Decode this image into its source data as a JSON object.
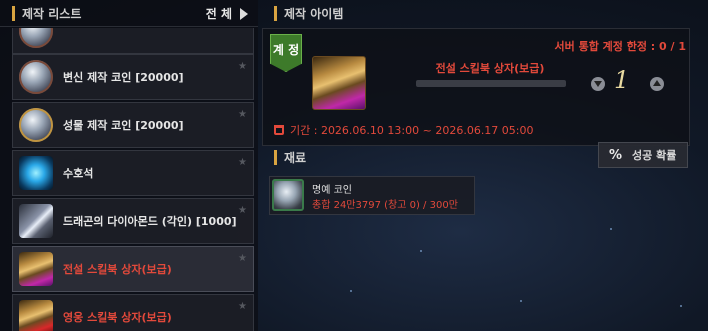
{
  "list_panel": {
    "title": "제작 리스트",
    "filter_label": "전 체",
    "items": [
      {
        "label": "",
        "icon": "coin-icon"
      },
      {
        "label": "변신 제작 코인 [20000]",
        "icon": "transform-coin-icon"
      },
      {
        "label": "성물 제작 코인 [20000]",
        "icon": "relic-coin-icon"
      },
      {
        "label": "수호석",
        "icon": "guardian-stone-icon"
      },
      {
        "label": "드래곤의 다이아몬드 (각인) [1000]",
        "icon": "dragon-diamond-icon"
      },
      {
        "label": "전설 스킬북 상자(보급)",
        "icon": "legend-skillbook-chest-icon",
        "selected": true
      },
      {
        "label": "영웅 스킬북 상자(보급)",
        "icon": "hero-skillbook-chest-icon"
      }
    ]
  },
  "craft_panel": {
    "title": "제작 아이템",
    "account_tag": "계 정",
    "server_limit": "서버 통합 계정 한정 : 0 / 1",
    "item_name": "전설 스킬북 상자(보급)",
    "quantity": "1",
    "period": "기간 : 2026.06.10 13:00 ~ 2026.06.17 05:00"
  },
  "materials": {
    "title": "재료",
    "success_button": {
      "symbol": "%",
      "label": "성공 확률"
    },
    "items": [
      {
        "name": "명예 코인",
        "quantity": "총합 24만3797 (창고 0) / 300만",
        "icon": "honor-coin-icon"
      }
    ]
  },
  "colors": {
    "accent_gold": "#d9a441",
    "alert_red": "#e2493b",
    "account_green": "#3d7a2a"
  }
}
